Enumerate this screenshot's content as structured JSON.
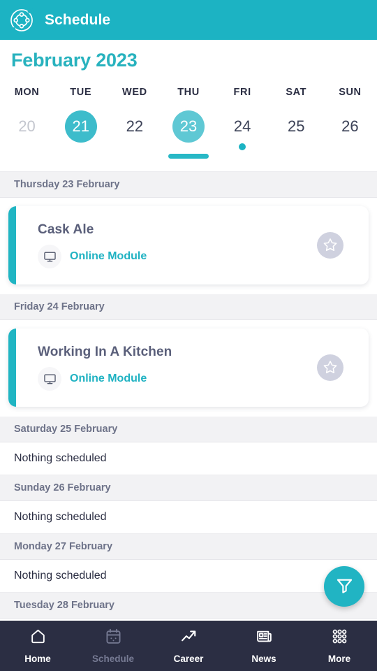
{
  "header": {
    "title": "Schedule",
    "logo_icon": "network-circle-logo",
    "background_color": "#1CB3C3"
  },
  "calendar": {
    "month_label": "February 2023",
    "month_color": "#28B2BE",
    "day_names": [
      "MON",
      "TUE",
      "WED",
      "THU",
      "FRI",
      "SAT",
      "SUN"
    ],
    "days": [
      {
        "number": "20",
        "state": "dim",
        "marker": "none"
      },
      {
        "number": "21",
        "state": "today",
        "marker": "none"
      },
      {
        "number": "22",
        "state": "normal",
        "marker": "none"
      },
      {
        "number": "23",
        "state": "selected",
        "marker": "white-dot"
      },
      {
        "number": "24",
        "state": "normal",
        "marker": "teal-dot"
      },
      {
        "number": "25",
        "state": "normal",
        "marker": "none"
      },
      {
        "number": "26",
        "state": "normal",
        "marker": "none"
      }
    ],
    "selected_index": 3
  },
  "schedule": {
    "sections": [
      {
        "date_label": "Thursday 23 February",
        "kind": "event",
        "event": {
          "title": "Cask Ale",
          "meta_label": "Online Module",
          "meta_icon": "monitor-icon",
          "favorite_icon": "star-icon",
          "favorited": false,
          "accent_color": "#20B5C3"
        }
      },
      {
        "date_label": "Friday 24 February",
        "kind": "event",
        "event": {
          "title": "Working In A Kitchen",
          "meta_label": "Online Module",
          "meta_icon": "monitor-icon",
          "favorite_icon": "star-icon",
          "favorited": false,
          "accent_color": "#20B5C3"
        }
      },
      {
        "date_label": "Saturday 25 February",
        "kind": "empty",
        "empty_text": "Nothing scheduled"
      },
      {
        "date_label": "Sunday 26 February",
        "kind": "empty",
        "empty_text": "Nothing scheduled"
      },
      {
        "date_label": "Monday 27 February",
        "kind": "empty",
        "empty_text": "Nothing scheduled"
      },
      {
        "date_label": "Tuesday 28 February",
        "kind": "header-only"
      }
    ]
  },
  "fab": {
    "icon": "filter-funnel-icon",
    "color": "#21B4C3"
  },
  "bottom_nav": {
    "background_color": "#2B2E43",
    "items": [
      {
        "label": "Home",
        "icon": "home-icon",
        "active": false
      },
      {
        "label": "Schedule",
        "icon": "calendar-icon",
        "active": true
      },
      {
        "label": "Career",
        "icon": "trending-up-icon",
        "active": false
      },
      {
        "label": "News",
        "icon": "newspaper-icon",
        "active": false
      },
      {
        "label": "More",
        "icon": "grid-dots-icon",
        "active": false
      }
    ]
  }
}
